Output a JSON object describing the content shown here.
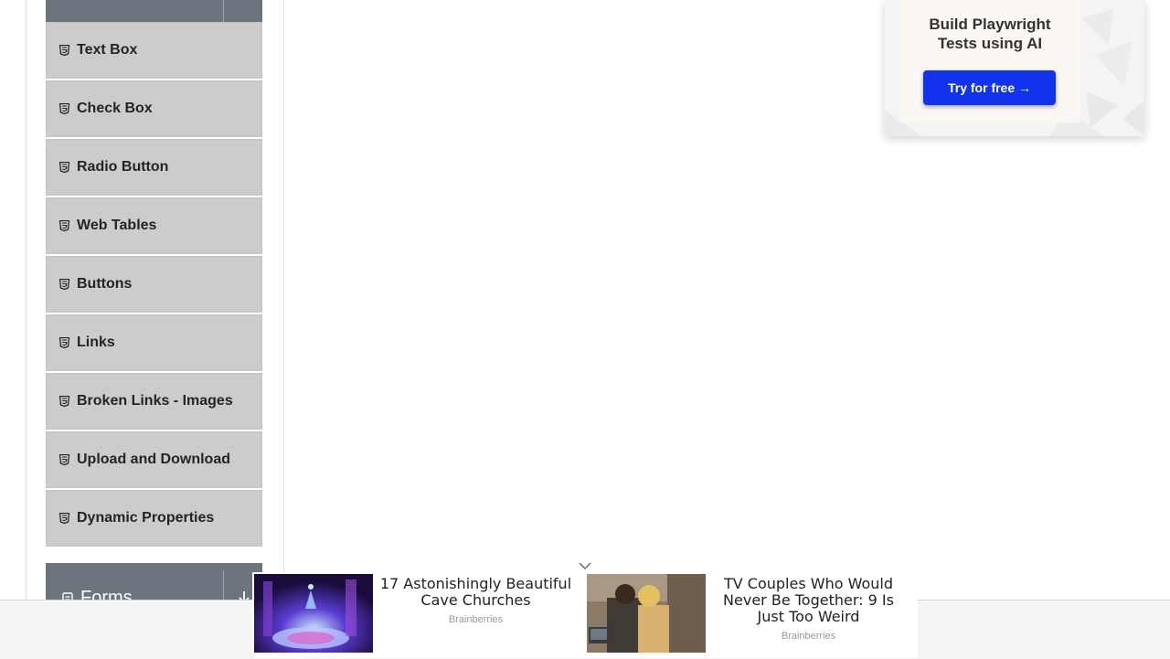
{
  "sidebar": {
    "items": [
      {
        "label": "Text Box",
        "icon": "html5-icon"
      },
      {
        "label": "Check Box",
        "icon": "html5-icon"
      },
      {
        "label": "Radio Button",
        "icon": "html5-icon"
      },
      {
        "label": "Web Tables",
        "icon": "html5-icon"
      },
      {
        "label": "Buttons",
        "icon": "html5-icon"
      },
      {
        "label": "Links",
        "icon": "html5-icon"
      },
      {
        "label": "Broken Links - Images",
        "icon": "html5-icon"
      },
      {
        "label": "Upload and Download",
        "icon": "html5-icon"
      },
      {
        "label": "Dynamic Properties",
        "icon": "html5-icon"
      }
    ],
    "next_group": {
      "label": "Forms",
      "icon": "document-icon"
    }
  },
  "ad_card": {
    "title_line1": "Build Playwright",
    "title_line2": "Tests using AI",
    "button_label": "Try for free →"
  },
  "bottom_ads": [
    {
      "headline": "17 Astonishingly Beautiful Cave Churches",
      "source": "Brainberries"
    },
    {
      "headline": "TV Couples Who Would Never Be Together: 9 Is Just Too Weird",
      "source": "Brainberries"
    }
  ],
  "colors": {
    "group_header": "#6c757d",
    "menu_item_bg": "#cccccc",
    "ad_button": "#1133ee"
  }
}
